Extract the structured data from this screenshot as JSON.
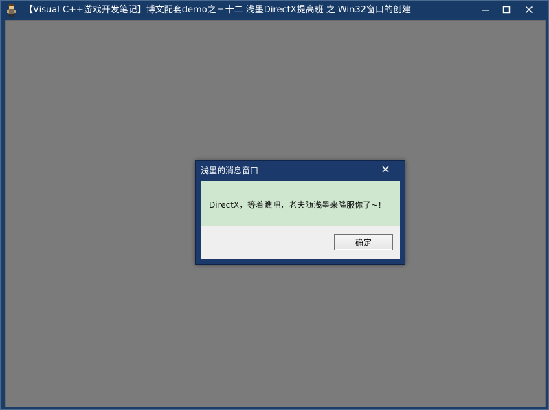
{
  "window": {
    "title": "【Visual C++游戏开发笔记】博文配套demo之三十二 浅墨DirectX提高班 之 Win32窗口的创建",
    "icon": "game-character-icon",
    "controls": {
      "minimize": "minimize-icon",
      "maximize": "maximize-icon",
      "close": "close-icon"
    }
  },
  "dialog": {
    "title": "浅墨的消息窗口",
    "message": "DirectX，等着瞧吧，老夫随浅墨来降服你了~!",
    "ok_label": "确定",
    "close_icon": "close-icon"
  },
  "colors": {
    "titlebar": "#173a66",
    "client_background": "#7b7b7b",
    "dialog_frame": "#1b3a6b",
    "dialog_message_background": "#cfe7cf",
    "dialog_footer": "#efefef"
  }
}
